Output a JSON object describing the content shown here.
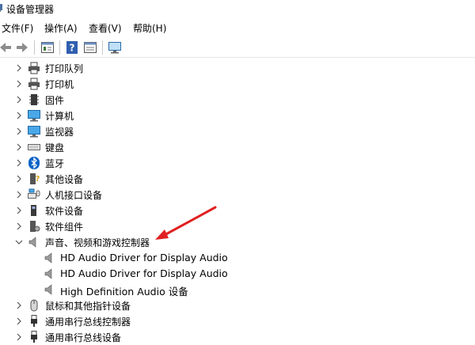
{
  "window": {
    "title": "设备管理器"
  },
  "menu": [
    "文件(F)",
    "操作(A)",
    "查看(V)",
    "帮助(H)"
  ],
  "toolbar": {
    "icons": [
      "back-arrow-icon",
      "forward-arrow-icon",
      "properties-icon",
      "help-icon",
      "view-details-icon",
      "monitor-scan-icon"
    ]
  },
  "tree": {
    "items": [
      {
        "label": "打印队列",
        "icon": "print-queue-icon",
        "expanded": false
      },
      {
        "label": "打印机",
        "icon": "printer-icon",
        "expanded": false
      },
      {
        "label": "固件",
        "icon": "firmware-icon",
        "expanded": false
      },
      {
        "label": "计算机",
        "icon": "computer-icon",
        "expanded": false
      },
      {
        "label": "监视器",
        "icon": "monitor-icon",
        "expanded": false
      },
      {
        "label": "键盘",
        "icon": "keyboard-icon",
        "expanded": false
      },
      {
        "label": "蓝牙",
        "icon": "bluetooth-icon",
        "expanded": false
      },
      {
        "label": "其他设备",
        "icon": "other-device-icon",
        "expanded": false
      },
      {
        "label": "人机接口设备",
        "icon": "hid-icon",
        "expanded": false
      },
      {
        "label": "软件设备",
        "icon": "software-device-icon",
        "expanded": false
      },
      {
        "label": "软件组件",
        "icon": "software-component-icon",
        "expanded": false
      },
      {
        "label": "声音、视频和游戏控制器",
        "icon": "speaker-icon",
        "expanded": true,
        "children": [
          {
            "label": "HD Audio Driver for Display Audio",
            "icon": "speaker-icon"
          },
          {
            "label": "HD Audio Driver for Display Audio",
            "icon": "speaker-icon"
          },
          {
            "label": "High Definition Audio 设备",
            "icon": "speaker-icon"
          }
        ]
      },
      {
        "label": "鼠标和其他指针设备",
        "icon": "mouse-icon",
        "expanded": false
      },
      {
        "label": "通用串行总线控制器",
        "icon": "usb-icon",
        "expanded": false
      },
      {
        "label": "通用串行总线设备",
        "icon": "usb-icon",
        "expanded": false
      }
    ]
  },
  "annotation": {
    "arrow_color": "#e02020",
    "points_to": "声音、视频和游戏控制器"
  },
  "colors": {
    "accent": "#0078d7",
    "arrow": "#e02020"
  }
}
